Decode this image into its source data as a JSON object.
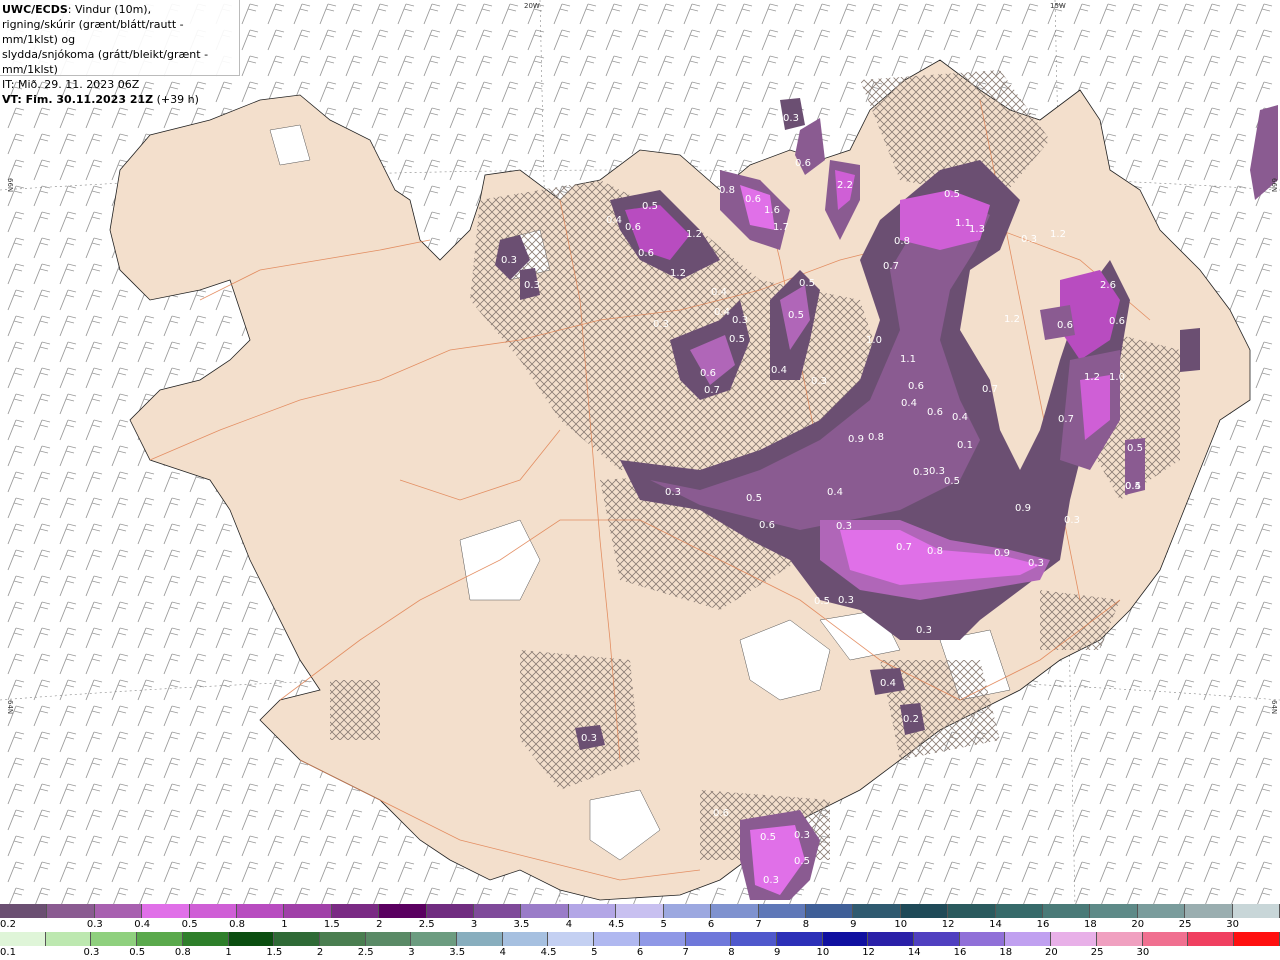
{
  "header": {
    "title_bold": "UWC/ECDS",
    "title_rest": ": Vindur (10m),",
    "line2": "rigning/skúrir (grænt/blátt/rautt - mm/1klst) og",
    "line3": "slydda/snjókoma (grátt/bleikt/grænt - mm/1klst)",
    "line4": "IT: Mið. 29. 11. 2023 06Z",
    "line5_bold": "VT: Fim. 30.11.2023 21Z",
    "line5_rest": " (+39 h)"
  },
  "grid_labels": {
    "lon_20w": "20W",
    "lon_15w": "15W",
    "lat_66n_left": "66N",
    "lat_64n_left": "64N",
    "lat_64n_right": "64N",
    "lat_66n_right": "66N"
  },
  "snow_values": [
    {
      "text": "0.3"
    },
    {
      "text": "0.6"
    },
    {
      "text": "2.2"
    },
    {
      "text": "0.5"
    },
    {
      "text": "1.1"
    },
    {
      "text": "1.3"
    },
    {
      "text": "0.8"
    },
    {
      "text": "0.7"
    },
    {
      "text": "0.3"
    },
    {
      "text": "1.2"
    },
    {
      "text": "2.6"
    },
    {
      "text": "0.6"
    },
    {
      "text": "0.6"
    },
    {
      "text": "1.2"
    },
    {
      "text": "1.2"
    },
    {
      "text": "1.0"
    },
    {
      "text": "0.7"
    },
    {
      "text": "0.7"
    },
    {
      "text": "0.4"
    },
    {
      "text": "0.5"
    },
    {
      "text": "0.5"
    },
    {
      "text": "0.3"
    },
    {
      "text": "0.9"
    },
    {
      "text": "0.8"
    },
    {
      "text": "1.1"
    },
    {
      "text": "1.0"
    },
    {
      "text": "0.6"
    },
    {
      "text": "0.4"
    },
    {
      "text": "0.6"
    },
    {
      "text": "0.1"
    },
    {
      "text": "0.9"
    },
    {
      "text": "0.3"
    },
    {
      "text": "0.3"
    },
    {
      "text": "0.4"
    },
    {
      "text": "0.5"
    },
    {
      "text": "0.3"
    },
    {
      "text": "0.5"
    },
    {
      "text": "0.6"
    },
    {
      "text": "0.3"
    },
    {
      "text": "0.7"
    },
    {
      "text": "0.8"
    },
    {
      "text": "0.9"
    },
    {
      "text": "0.3"
    },
    {
      "text": "0.3"
    },
    {
      "text": "0.3"
    },
    {
      "text": "0.4"
    },
    {
      "text": "0.2"
    },
    {
      "text": "0.3"
    },
    {
      "text": "0.6"
    },
    {
      "text": "0.5"
    },
    {
      "text": "0.3"
    },
    {
      "text": "0.5"
    },
    {
      "text": "0.3"
    },
    {
      "text": "0.4"
    },
    {
      "text": "0.6"
    },
    {
      "text": "0.5"
    },
    {
      "text": "0.4"
    },
    {
      "text": "1.6"
    },
    {
      "text": "1.7"
    },
    {
      "text": "0.8"
    },
    {
      "text": "0.6"
    },
    {
      "text": "0.5"
    },
    {
      "text": "0.4"
    },
    {
      "text": "1.2"
    },
    {
      "text": "1.2"
    },
    {
      "text": "0.6"
    },
    {
      "text": "0.4"
    },
    {
      "text": "0.5"
    },
    {
      "text": "0.3"
    },
    {
      "text": "0.6"
    },
    {
      "text": "0.7"
    },
    {
      "text": "0.5"
    },
    {
      "text": "0.4"
    },
    {
      "text": "0.3"
    },
    {
      "text": "0.3"
    },
    {
      "text": "0.3"
    },
    {
      "text": "0.3"
    },
    {
      "text": "0.5"
    }
  ],
  "legend_snow": {
    "colors": [
      "#6b4f72",
      "#8a5b91",
      "#a860b0",
      "#e070e8",
      "#cf5fd6",
      "#b84cc0",
      "#a040a8",
      "#7a2a84",
      "#5a0060",
      "#702c80",
      "#7f4a9a",
      "#9a7cc8",
      "#b3a6e6",
      "#c8c0f0",
      "#9ca8e0",
      "#7f92cf",
      "#5f78b8",
      "#3f5f98",
      "#2f5a70",
      "#1f4a58",
      "#2a5a5e",
      "#366a6a",
      "#4a7a78",
      "#5e8a88",
      "#7a9c9c",
      "#9aaeb0",
      "#c8d6d8"
    ],
    "labels": [
      "0.2",
      "0.3",
      "0.4",
      "0.5",
      "0.8",
      "1",
      "1.5",
      "2",
      "2.5",
      "3",
      "3.5",
      "4",
      "4.5",
      "5",
      "6",
      "7",
      "8",
      "9",
      "10",
      "12",
      "14",
      "16",
      "18",
      "20",
      "25",
      "30"
    ]
  },
  "legend_rain": {
    "colors": [
      "#dff5d8",
      "#bde8b0",
      "#8fd07e",
      "#5aa94c",
      "#2e7f2a",
      "#0b4e10",
      "#2f6a36",
      "#4a7e50",
      "#5a8a66",
      "#6c9c80",
      "#88aebe",
      "#a6c0e0",
      "#c4d0f2",
      "#b0b8f0",
      "#8f98e6",
      "#6f78da",
      "#4f58cc",
      "#2c30b8",
      "#1010a0",
      "#2a20a8",
      "#5040c0",
      "#9070d8",
      "#c0a0f0",
      "#e8b0e8",
      "#f0a0c0",
      "#f07090",
      "#f04060",
      "#ff1010"
    ],
    "labels": [
      "0.1",
      "0.3",
      "0.5",
      "0.8",
      "1",
      "1.5",
      "2",
      "2.5",
      "3",
      "3.5",
      "4",
      "4.5",
      "5",
      "6",
      "7",
      "8",
      "9",
      "10",
      "12",
      "14",
      "16",
      "18",
      "20",
      "25",
      "30"
    ]
  }
}
